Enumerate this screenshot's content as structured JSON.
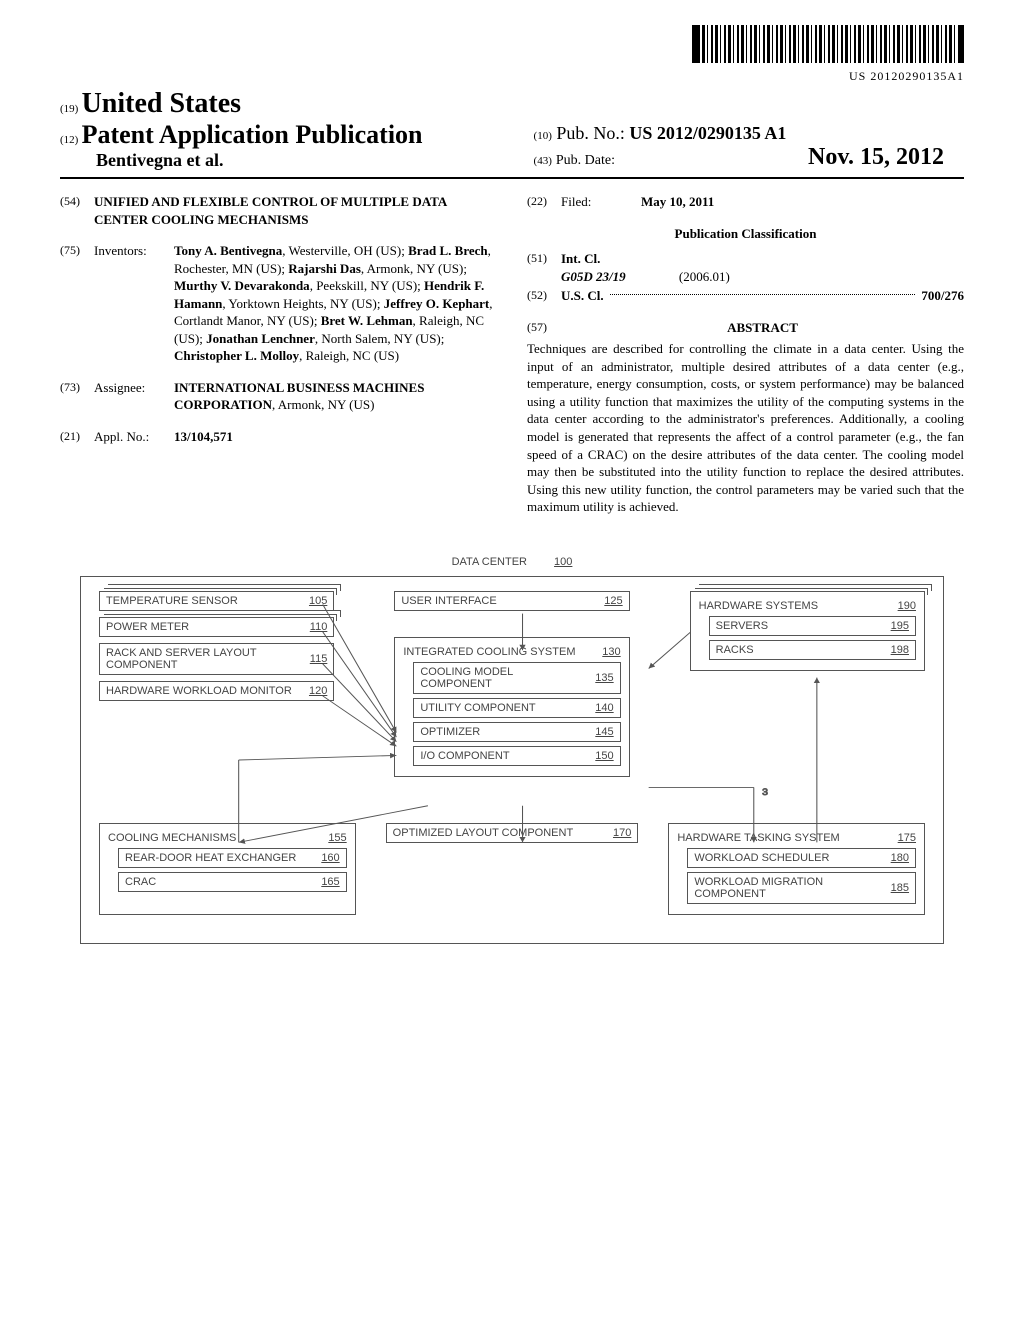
{
  "barcode_number": "US 20120290135A1",
  "header": {
    "prefix19": "(19)",
    "country": "United States",
    "prefix12": "(12)",
    "doc_type": "Patent Application Publication",
    "authors_line": "Bentivegna et al.",
    "prefix10": "(10)",
    "pub_no_label": "Pub. No.:",
    "pub_no": "US 2012/0290135 A1",
    "prefix43": "(43)",
    "pub_date_label": "Pub. Date:",
    "pub_date": "Nov. 15, 2012"
  },
  "left": {
    "n54": "(54)",
    "title": "UNIFIED AND FLEXIBLE CONTROL OF MULTIPLE DATA CENTER COOLING MECHANISMS",
    "n75": "(75)",
    "inventors_label": "Inventors:",
    "inventors_html": "Tony A. Bentivegna, Westerville, OH (US); Brad L. Brech, Rochester, MN (US); Rajarshi Das, Armonk, NY (US); Murthy V. Devarakonda, Peekskill, NY (US); Hendrik F. Hamann, Yorktown Heights, NY (US); Jeffrey O. Kephart, Cortlandt Manor, NY (US); Bret W. Lehman, Raleigh, NC (US); Jonathan Lenchner, North Salem, NY (US); Christopher L. Molloy, Raleigh, NC (US)",
    "n73": "(73)",
    "assignee_label": "Assignee:",
    "assignee": "INTERNATIONAL BUSINESS MACHINES CORPORATION, Armonk, NY (US)",
    "n21": "(21)",
    "appl_label": "Appl. No.:",
    "appl_no": "13/104,571"
  },
  "right": {
    "n22": "(22)",
    "filed_label": "Filed:",
    "filed": "May 10, 2011",
    "pub_class_heading": "Publication Classification",
    "n51": "(51)",
    "intcl_label": "Int. Cl.",
    "intcl_code": "G05D 23/19",
    "intcl_date": "(2006.01)",
    "n52": "(52)",
    "uscl_label": "U.S. Cl.",
    "uscl_value": "700/276",
    "n57": "(57)",
    "abstract_heading": "ABSTRACT",
    "abstract": "Techniques are described for controlling the climate in a data center. Using the input of an administrator, multiple desired attributes of a data center (e.g., temperature, energy consumption, costs, or system performance) may be balanced using a utility function that maximizes the utility of the computing systems in the data center according to the administrator's preferences. Additionally, a cooling model is generated that represents the affect of a control parameter (e.g., the fan speed of a CRAC) on the desire attributes of the data center. The cooling model may then be substituted into the utility function to replace the desired attributes. Using this new utility function, the control parameters may be varied such that the maximum utility is achieved."
  },
  "diagram": {
    "title": "DATA CENTER",
    "title_num": "100",
    "temp_sensor": "TEMPERATURE SENSOR",
    "temp_sensor_n": "105",
    "power_meter": "POWER METER",
    "power_meter_n": "110",
    "rack_layout": "RACK AND SERVER LAYOUT COMPONENT",
    "rack_layout_n": "115",
    "hw_monitor": "HARDWARE WORKLOAD MONITOR",
    "hw_monitor_n": "120",
    "ui": "USER INTERFACE",
    "ui_n": "125",
    "ics": "INTEGRATED COOLING SYSTEM",
    "ics_n": "130",
    "cooling_model": "COOLING MODEL COMPONENT",
    "cooling_model_n": "135",
    "utility": "UTILITY COMPONENT",
    "utility_n": "140",
    "optimizer": "OPTIMIZER",
    "optimizer_n": "145",
    "io": "I/O COMPONENT",
    "io_n": "150",
    "hw_sys": "HARDWARE SYSTEMS",
    "hw_sys_n": "190",
    "servers": "SERVERS",
    "servers_n": "195",
    "racks": "RACKS",
    "racks_n": "198",
    "cooling_mech": "COOLING MECHANISMS",
    "cooling_mech_n": "155",
    "rdhx": "REAR-DOOR HEAT EXCHANGER",
    "rdhx_n": "160",
    "crac": "CRAC",
    "crac_n": "165",
    "opt_layout": "OPTIMIZED LAYOUT COMPONENT",
    "opt_layout_n": "170",
    "hw_task": "HARDWARE TASKING SYSTEM",
    "hw_task_n": "175",
    "sched": "WORKLOAD SCHEDULER",
    "sched_n": "180",
    "migration": "WORKLOAD MIGRATION COMPONENT",
    "migration_n": "185",
    "conn_label": "3"
  }
}
